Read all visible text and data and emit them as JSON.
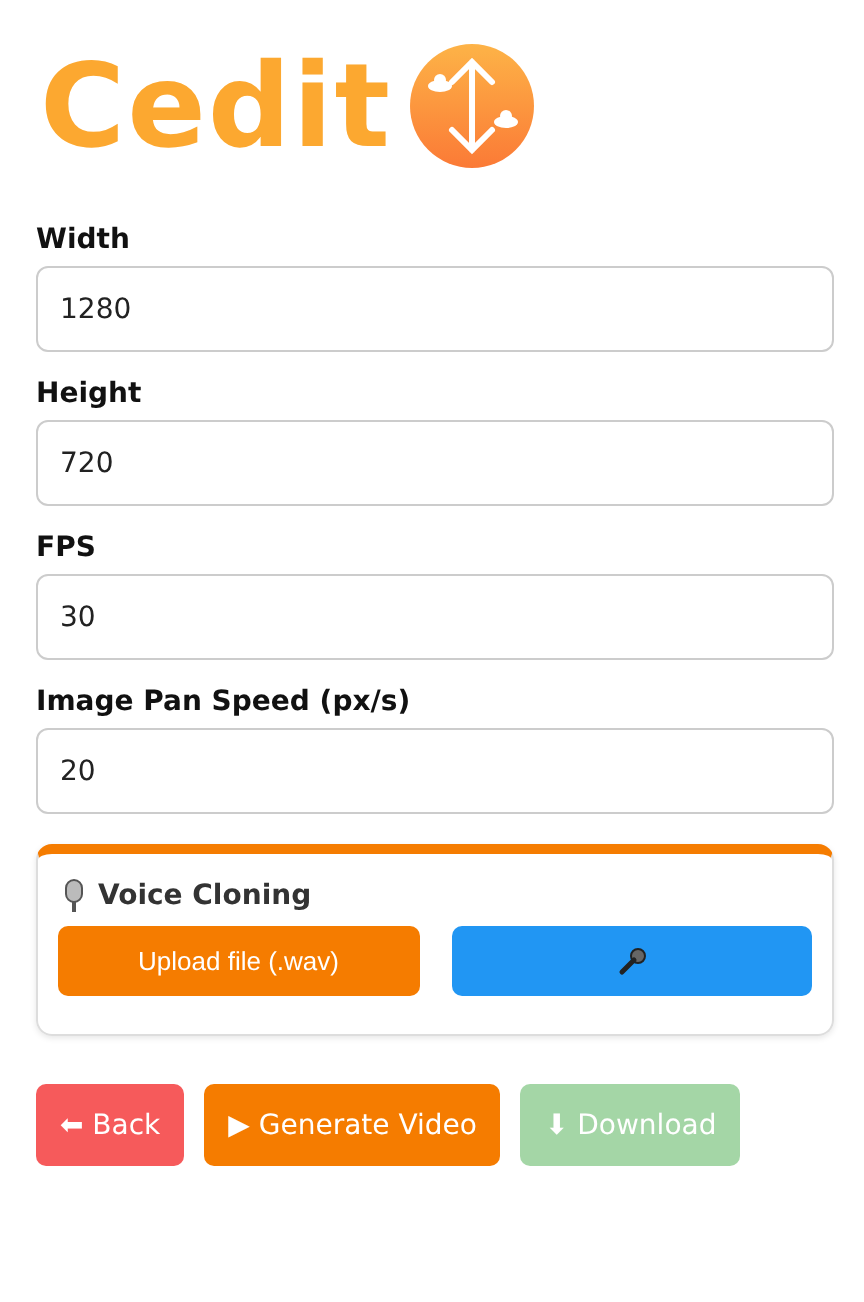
{
  "logo": {
    "text": "Cedit"
  },
  "fields": [
    {
      "label": "Width",
      "value": "1280"
    },
    {
      "label": "Height",
      "value": "720"
    },
    {
      "label": "FPS",
      "value": "30"
    },
    {
      "label": "Image Pan Speed (px/s)",
      "value": "20"
    }
  ],
  "voice_cloning": {
    "title": "Voice Cloning",
    "upload_button": "Upload file (.wav)"
  },
  "actions": [
    {
      "label": "⬅ Back",
      "kind": "danger",
      "disabled": false
    },
    {
      "label": "▶ Generate Video",
      "kind": "primary",
      "disabled": false
    },
    {
      "label": "⬇ Download",
      "kind": "success",
      "disabled": true
    }
  ]
}
